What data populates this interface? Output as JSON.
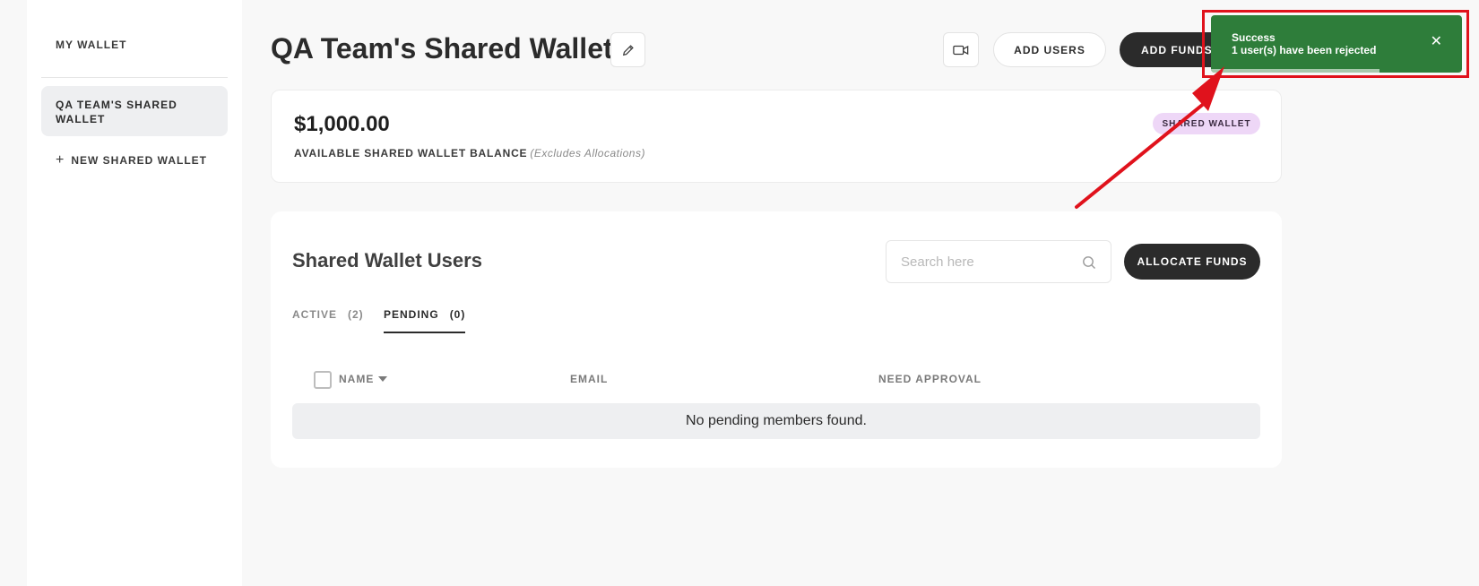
{
  "sidebar": {
    "my_wallet": "MY WALLET",
    "active_item": "QA TEAM'S SHARED WALLET",
    "new_shared_wallet": "NEW SHARED WALLET"
  },
  "header": {
    "title": "QA Team's Shared Wallet",
    "add_users": "ADD USERS",
    "add_funds": "ADD FUNDS"
  },
  "balance": {
    "amount": "$1,000.00",
    "label": "AVAILABLE SHARED WALLET BALANCE",
    "note": "(Excludes Allocations)",
    "badge": "SHARED WALLET"
  },
  "users": {
    "title": "Shared Wallet Users",
    "search_placeholder": "Search here",
    "allocate_funds": "ALLOCATE FUNDS",
    "tabs": [
      {
        "label": "ACTIVE",
        "count": "(2)"
      },
      {
        "label": "PENDING",
        "count": "(0)"
      }
    ],
    "columns": [
      "NAME",
      "EMAIL",
      "NEED APPROVAL"
    ],
    "empty_message": "No pending members found."
  },
  "toast": {
    "title": "Success",
    "message": "1 user(s) have been rejected",
    "close": "✕",
    "progress": 0.67
  },
  "colors": {
    "toast_bg": "#2e7d3a",
    "annotation": "#e0121c",
    "badge_bg": "#eed7f7"
  }
}
